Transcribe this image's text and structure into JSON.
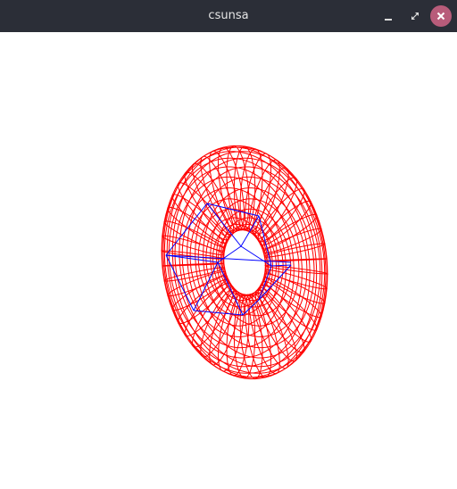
{
  "window": {
    "title": "csunsa",
    "minimize_icon": "minimize-icon",
    "maximize_icon": "maximize-icon",
    "close_icon": "close-icon"
  },
  "scene": {
    "background": "#ffffff",
    "torus": {
      "color": "#ff0000",
      "ring_segments": 48,
      "tube_segments": 24
    },
    "cube": {
      "color": "#0000ff"
    }
  }
}
